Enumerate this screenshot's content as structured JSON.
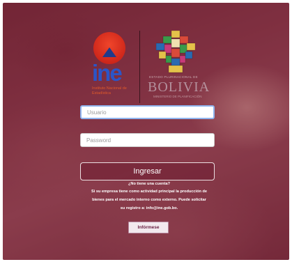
{
  "ine_logo": {
    "wordmark": "ine",
    "subtitle": "Instituto Nacional de Estadística"
  },
  "bolivia_logo": {
    "top_text": "ESTADO PLURINACIONAL DE",
    "wordmark": "BOLIVIA",
    "sub_text": "MINISTERIO DE PLANIFICACIÓN"
  },
  "login": {
    "username_placeholder": "Usuario",
    "password_placeholder": "Password",
    "submit_label": "Ingresar"
  },
  "info": {
    "question": "¿No tiene una cuenta?",
    "line1": "Si su empresa tiene como actividad principal la producción de",
    "line2": "bienes para el mercado interno como externo.  Puede solicitar",
    "line3": "su registro a: info@ine.gob.bo.",
    "button_label": "Infórmese"
  },
  "colors": {
    "background": "#8c3a4a",
    "ine_red": "#d8261c",
    "ine_blue": "#2b55c8",
    "informese_text": "#6b2244"
  }
}
